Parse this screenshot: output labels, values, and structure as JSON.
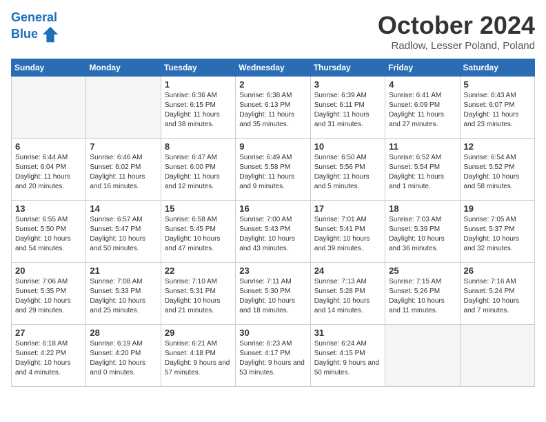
{
  "header": {
    "logo_line1": "General",
    "logo_line2": "Blue",
    "month_title": "October 2024",
    "location": "Radlow, Lesser Poland, Poland"
  },
  "weekdays": [
    "Sunday",
    "Monday",
    "Tuesday",
    "Wednesday",
    "Thursday",
    "Friday",
    "Saturday"
  ],
  "weeks": [
    [
      {
        "day": "",
        "empty": true
      },
      {
        "day": "",
        "empty": true
      },
      {
        "day": "1",
        "sunrise": "Sunrise: 6:36 AM",
        "sunset": "Sunset: 6:15 PM",
        "daylight": "Daylight: 11 hours and 38 minutes."
      },
      {
        "day": "2",
        "sunrise": "Sunrise: 6:38 AM",
        "sunset": "Sunset: 6:13 PM",
        "daylight": "Daylight: 11 hours and 35 minutes."
      },
      {
        "day": "3",
        "sunrise": "Sunrise: 6:39 AM",
        "sunset": "Sunset: 6:11 PM",
        "daylight": "Daylight: 11 hours and 31 minutes."
      },
      {
        "day": "4",
        "sunrise": "Sunrise: 6:41 AM",
        "sunset": "Sunset: 6:09 PM",
        "daylight": "Daylight: 11 hours and 27 minutes."
      },
      {
        "day": "5",
        "sunrise": "Sunrise: 6:43 AM",
        "sunset": "Sunset: 6:07 PM",
        "daylight": "Daylight: 11 hours and 23 minutes."
      }
    ],
    [
      {
        "day": "6",
        "sunrise": "Sunrise: 6:44 AM",
        "sunset": "Sunset: 6:04 PM",
        "daylight": "Daylight: 11 hours and 20 minutes."
      },
      {
        "day": "7",
        "sunrise": "Sunrise: 6:46 AM",
        "sunset": "Sunset: 6:02 PM",
        "daylight": "Daylight: 11 hours and 16 minutes."
      },
      {
        "day": "8",
        "sunrise": "Sunrise: 6:47 AM",
        "sunset": "Sunset: 6:00 PM",
        "daylight": "Daylight: 11 hours and 12 minutes."
      },
      {
        "day": "9",
        "sunrise": "Sunrise: 6:49 AM",
        "sunset": "Sunset: 5:58 PM",
        "daylight": "Daylight: 11 hours and 9 minutes."
      },
      {
        "day": "10",
        "sunrise": "Sunrise: 6:50 AM",
        "sunset": "Sunset: 5:56 PM",
        "daylight": "Daylight: 11 hours and 5 minutes."
      },
      {
        "day": "11",
        "sunrise": "Sunrise: 6:52 AM",
        "sunset": "Sunset: 5:54 PM",
        "daylight": "Daylight: 11 hours and 1 minute."
      },
      {
        "day": "12",
        "sunrise": "Sunrise: 6:54 AM",
        "sunset": "Sunset: 5:52 PM",
        "daylight": "Daylight: 10 hours and 58 minutes."
      }
    ],
    [
      {
        "day": "13",
        "sunrise": "Sunrise: 6:55 AM",
        "sunset": "Sunset: 5:50 PM",
        "daylight": "Daylight: 10 hours and 54 minutes."
      },
      {
        "day": "14",
        "sunrise": "Sunrise: 6:57 AM",
        "sunset": "Sunset: 5:47 PM",
        "daylight": "Daylight: 10 hours and 50 minutes."
      },
      {
        "day": "15",
        "sunrise": "Sunrise: 6:58 AM",
        "sunset": "Sunset: 5:45 PM",
        "daylight": "Daylight: 10 hours and 47 minutes."
      },
      {
        "day": "16",
        "sunrise": "Sunrise: 7:00 AM",
        "sunset": "Sunset: 5:43 PM",
        "daylight": "Daylight: 10 hours and 43 minutes."
      },
      {
        "day": "17",
        "sunrise": "Sunrise: 7:01 AM",
        "sunset": "Sunset: 5:41 PM",
        "daylight": "Daylight: 10 hours and 39 minutes."
      },
      {
        "day": "18",
        "sunrise": "Sunrise: 7:03 AM",
        "sunset": "Sunset: 5:39 PM",
        "daylight": "Daylight: 10 hours and 36 minutes."
      },
      {
        "day": "19",
        "sunrise": "Sunrise: 7:05 AM",
        "sunset": "Sunset: 5:37 PM",
        "daylight": "Daylight: 10 hours and 32 minutes."
      }
    ],
    [
      {
        "day": "20",
        "sunrise": "Sunrise: 7:06 AM",
        "sunset": "Sunset: 5:35 PM",
        "daylight": "Daylight: 10 hours and 29 minutes."
      },
      {
        "day": "21",
        "sunrise": "Sunrise: 7:08 AM",
        "sunset": "Sunset: 5:33 PM",
        "daylight": "Daylight: 10 hours and 25 minutes."
      },
      {
        "day": "22",
        "sunrise": "Sunrise: 7:10 AM",
        "sunset": "Sunset: 5:31 PM",
        "daylight": "Daylight: 10 hours and 21 minutes."
      },
      {
        "day": "23",
        "sunrise": "Sunrise: 7:11 AM",
        "sunset": "Sunset: 5:30 PM",
        "daylight": "Daylight: 10 hours and 18 minutes."
      },
      {
        "day": "24",
        "sunrise": "Sunrise: 7:13 AM",
        "sunset": "Sunset: 5:28 PM",
        "daylight": "Daylight: 10 hours and 14 minutes."
      },
      {
        "day": "25",
        "sunrise": "Sunrise: 7:15 AM",
        "sunset": "Sunset: 5:26 PM",
        "daylight": "Daylight: 10 hours and 11 minutes."
      },
      {
        "day": "26",
        "sunrise": "Sunrise: 7:16 AM",
        "sunset": "Sunset: 5:24 PM",
        "daylight": "Daylight: 10 hours and 7 minutes."
      }
    ],
    [
      {
        "day": "27",
        "sunrise": "Sunrise: 6:18 AM",
        "sunset": "Sunset: 4:22 PM",
        "daylight": "Daylight: 10 hours and 4 minutes."
      },
      {
        "day": "28",
        "sunrise": "Sunrise: 6:19 AM",
        "sunset": "Sunset: 4:20 PM",
        "daylight": "Daylight: 10 hours and 0 minutes."
      },
      {
        "day": "29",
        "sunrise": "Sunrise: 6:21 AM",
        "sunset": "Sunset: 4:18 PM",
        "daylight": "Daylight: 9 hours and 57 minutes."
      },
      {
        "day": "30",
        "sunrise": "Sunrise: 6:23 AM",
        "sunset": "Sunset: 4:17 PM",
        "daylight": "Daylight: 9 hours and 53 minutes."
      },
      {
        "day": "31",
        "sunrise": "Sunrise: 6:24 AM",
        "sunset": "Sunset: 4:15 PM",
        "daylight": "Daylight: 9 hours and 50 minutes."
      },
      {
        "day": "",
        "empty": true
      },
      {
        "day": "",
        "empty": true
      }
    ]
  ]
}
